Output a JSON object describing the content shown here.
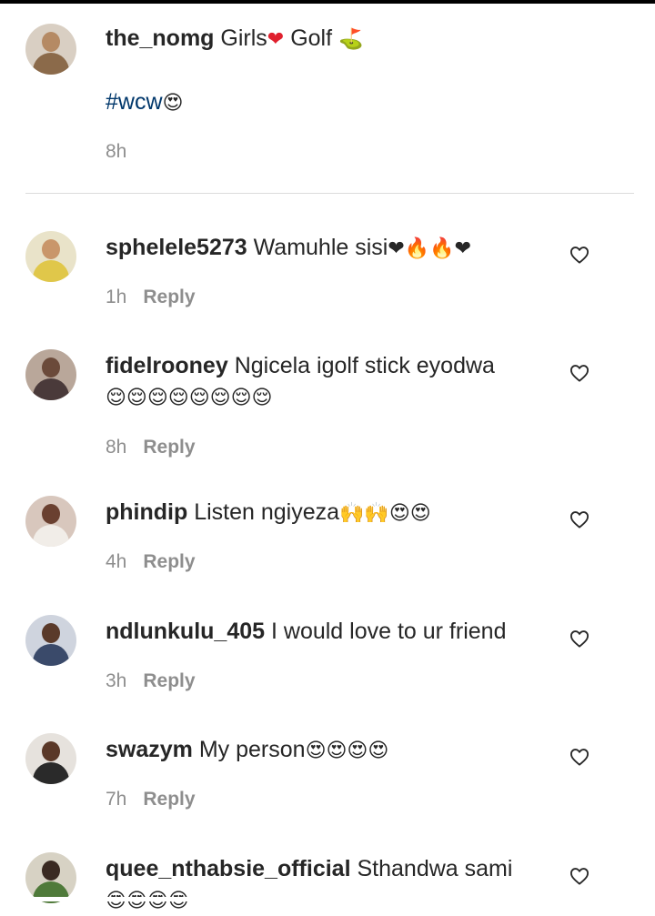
{
  "caption": {
    "username": "the_nomg",
    "text_prefix": "Girls",
    "text_heart": "❤",
    "text_mid": "Golf",
    "text_flag": "⛳",
    "hashtag": "#wcw",
    "hashtag_emoji": "😍",
    "time": "8h",
    "avatar": {
      "skin": "#b58a64",
      "shirt": "#8b6a4a",
      "bg": "#d9cfc3"
    }
  },
  "comments": [
    {
      "username": "sphelele5273",
      "text": "Wamuhle sisi",
      "emojis": "❤🔥🔥❤",
      "continuation": "",
      "time": "1h",
      "reply_label": "Reply",
      "like_icon": "heart-outline-icon",
      "avatar": {
        "skin": "#c9966a",
        "shirt": "#e0c74a",
        "bg": "#e9e3c9"
      }
    },
    {
      "username": "fidelrooney",
      "text": "Ngicela igolf stick eyodwa",
      "emojis": "",
      "continuation": "😌😌😌😌😌😌😌😌",
      "time": "8h",
      "reply_label": "Reply",
      "like_icon": "heart-outline-icon",
      "avatar": {
        "skin": "#6b4a3a",
        "shirt": "#4a3a3a",
        "bg": "#b9a79a"
      }
    },
    {
      "username": "phindip",
      "text": "Listen ngiyeza",
      "emojis": "🙌🙌😍😍",
      "continuation": "",
      "time": "4h",
      "reply_label": "Reply",
      "like_icon": "heart-outline-icon",
      "avatar": {
        "skin": "#6a4030",
        "shirt": "#f1ede8",
        "bg": "#d8c7bd"
      }
    },
    {
      "username": "ndlunkulu_405",
      "text": "I would love to ur friend",
      "emojis": "",
      "continuation": "",
      "time": "3h",
      "reply_label": "Reply",
      "like_icon": "heart-outline-icon",
      "avatar": {
        "skin": "#5a3a2a",
        "shirt": "#3a4a6a",
        "bg": "#cfd4de"
      }
    },
    {
      "username": "swazym",
      "text": "My person",
      "emojis": "😍😍😍😍",
      "continuation": "",
      "time": "7h",
      "reply_label": "Reply",
      "like_icon": "heart-outline-icon",
      "avatar": {
        "skin": "#5a3828",
        "shirt": "#2a2a2a",
        "bg": "#e6e2dd"
      }
    },
    {
      "username": "quee_nthabsie_official",
      "text": "Sthandwa sami",
      "emojis": "",
      "continuation": "😍😍😍😍",
      "time": "",
      "reply_label": "",
      "like_icon": "heart-outline-icon",
      "avatar": {
        "skin": "#3a2a22",
        "shirt": "#4f7a3a",
        "bg": "#d7d2c4"
      }
    }
  ]
}
